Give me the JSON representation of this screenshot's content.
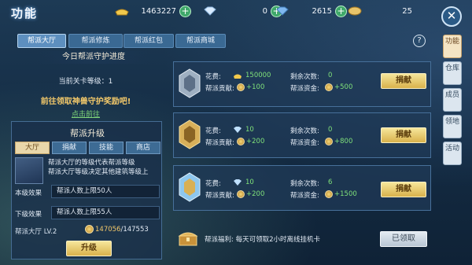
{
  "title": "功能",
  "resources": [
    {
      "icon": "gold-ingot-icon",
      "value": "1463227"
    },
    {
      "icon": "diamond-icon",
      "value": "0"
    },
    {
      "icon": "blue-diamond-icon",
      "value": "2615"
    },
    {
      "icon": "coin-purse-icon",
      "value": "25"
    }
  ],
  "tabs": [
    "帮派大厅",
    "帮派修炼",
    "帮派红包",
    "帮派商城"
  ],
  "side_tabs": [
    "功能",
    "仓库",
    "成员",
    "领地",
    "活动"
  ],
  "guard": {
    "banner": "今日帮派守护进度",
    "level_label": "当前关卡等级：",
    "level_value": "1",
    "beast_text": "前往领取神兽守护奖励吧!",
    "goto_link": "点击前往"
  },
  "upgrade": {
    "title": "帮派升级",
    "sub_tabs": [
      "大厅",
      "捐献",
      "技能",
      "商店"
    ],
    "desc_line1": "帮派大厅的等级代表帮派等级",
    "desc_line2": "帮派大厅等级决定其他建筑等级上",
    "current_label": "本级效果",
    "current_value": "帮派人数上限50人",
    "next_label": "下级效果",
    "next_value": "帮派人数上限55人",
    "hall_level": "帮派大厅 LV.2",
    "progress_current": "147056",
    "progress_sep": "/",
    "progress_max": "147553",
    "upgrade_button": "升级"
  },
  "donations": [
    {
      "cost_label": "花费:",
      "cost_value": "150000",
      "contrib_label": "帮派贡献:",
      "contrib_value": "+100",
      "remain_label": "剩余次数:",
      "remain_value": "0",
      "fund_label": "帮派资金:",
      "fund_value": "+500",
      "button": "捐献"
    },
    {
      "cost_label": "花费:",
      "cost_value": "10",
      "contrib_label": "帮派贡献:",
      "contrib_value": "+200",
      "remain_label": "剩余次数:",
      "remain_value": "0",
      "fund_label": "帮派资金:",
      "fund_value": "+800",
      "button": "捐献"
    },
    {
      "cost_label": "花费:",
      "cost_value": "10",
      "contrib_label": "帮派贡献:",
      "contrib_value": "+200",
      "remain_label": "剩余次数:",
      "remain_value": "6",
      "fund_label": "帮派资金:",
      "fund_value": "+1500",
      "button": "捐献"
    }
  ],
  "welfare": {
    "text": "帮派福利:   每天可领取2小时离线挂机卡",
    "button": "已领取"
  }
}
